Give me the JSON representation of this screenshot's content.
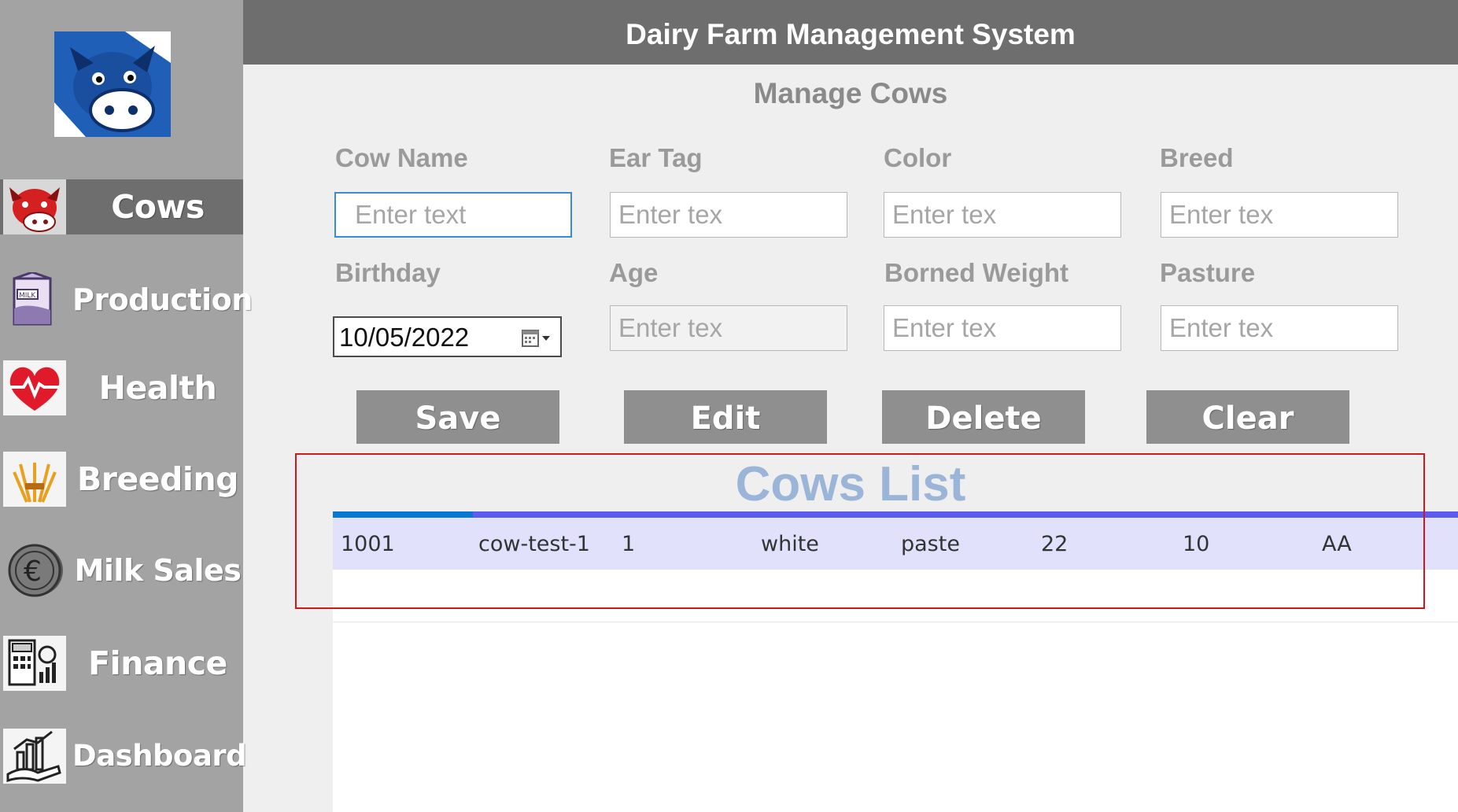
{
  "header": {
    "title": "Dairy Farm Management System"
  },
  "page": {
    "title": "Manage Cows"
  },
  "sidebar": {
    "items": [
      {
        "label": "Cows",
        "icon": "cow-icon",
        "active": true
      },
      {
        "label": "Production",
        "icon": "milk-carton-icon",
        "active": false
      },
      {
        "label": "Health",
        "icon": "heart-pulse-icon",
        "active": false
      },
      {
        "label": "Breeding",
        "icon": "wheat-icon",
        "active": false
      },
      {
        "label": "Milk Sales",
        "icon": "euro-coin-icon",
        "active": false
      },
      {
        "label": "Finance",
        "icon": "calculator-chart-icon",
        "active": false
      },
      {
        "label": "Dashboard",
        "icon": "dashboard-chart-icon",
        "active": false
      }
    ]
  },
  "form": {
    "cow_name": {
      "label": "Cow Name",
      "placeholder": "Enter text"
    },
    "ear_tag": {
      "label": "Ear Tag",
      "placeholder": "Enter tex"
    },
    "color": {
      "label": "Color",
      "placeholder": "Enter tex"
    },
    "breed": {
      "label": "Breed",
      "placeholder": "Enter tex"
    },
    "birthday": {
      "label": "Birthday",
      "value": "10/05/2022"
    },
    "age": {
      "label": "Age",
      "placeholder": "Enter tex"
    },
    "borned_weight": {
      "label": "Borned Weight",
      "placeholder": "Enter tex"
    },
    "pasture": {
      "label": "Pasture",
      "placeholder": "Enter tex"
    }
  },
  "buttons": {
    "save": "Save",
    "edit": "Edit",
    "delete": "Delete",
    "clear": "Clear"
  },
  "list": {
    "title": "Cows List",
    "rows": [
      [
        "1001",
        "cow-test-1",
        "1",
        "white",
        "paste",
        "22",
        "10",
        "AA"
      ]
    ]
  },
  "colors": {
    "header_bg": "#6e6e6e",
    "sidebar_bg": "#a3a3a3",
    "button_bg": "#8f8f8f",
    "list_title": "#9bb5d8",
    "row_bg": "#e1e1fb",
    "header_accent": "#5c5cee",
    "highlight": "#d01818"
  }
}
